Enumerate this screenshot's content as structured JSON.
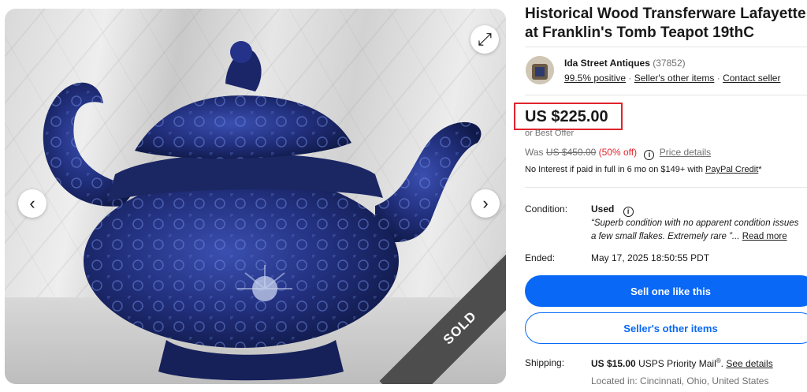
{
  "gallery": {
    "prev_icon": "‹",
    "next_icon": "›",
    "expand_icon": "⤢",
    "sold_label": "SOLD"
  },
  "listing": {
    "title": "Historical Wood Transferware Lafayette at Franklin's Tomb Teapot 19thC"
  },
  "seller": {
    "name": "Ida Street Antiques",
    "feedback_count": "(37852)",
    "positive": "99.5% positive",
    "other_items": "Seller's other items",
    "contact": "Contact seller",
    "separator": "·"
  },
  "price": {
    "current": "US $225.00",
    "best_offer": "or Best Offer",
    "was_prefix": "Was",
    "was_price": "US $450.00",
    "discount": "(50% off)",
    "price_details": "Price details",
    "no_interest": "No Interest if paid in full in 6 mo on $149+ with",
    "paypal_credit": "PayPal Credit",
    "asterisk": "*"
  },
  "condition": {
    "label": "Condition:",
    "value": "Used",
    "quote_line1": "“Superb condition with no apparent condition issues",
    "quote_line2": "a few small flakes. Extremely rare ”...",
    "read_more": "Read more"
  },
  "ended": {
    "label": "Ended:",
    "value": "May 17, 2025 18:50:55 PDT"
  },
  "actions": {
    "sell_one": "Sell one like this",
    "other_items": "Seller's other items"
  },
  "shipping": {
    "label": "Shipping:",
    "price": "US $15.00",
    "service": "USPS Priority Mail",
    "registered": "®",
    "see_details": "See details",
    "located": "Located in: Cincinnati, Ohio, United States"
  },
  "colors": {
    "accent": "#0968f6",
    "highlight_box": "#e0242c",
    "sold_ribbon": "#4d4d4d"
  }
}
